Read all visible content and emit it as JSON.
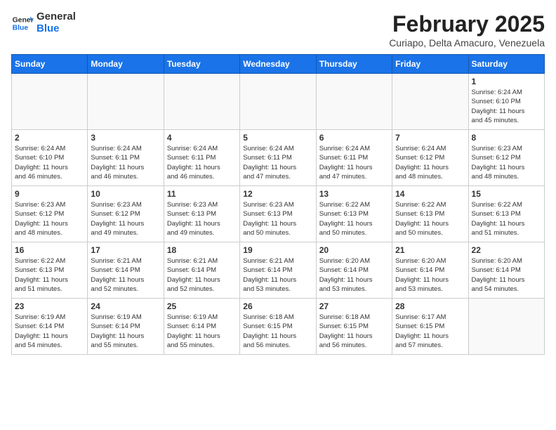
{
  "header": {
    "logo_line1": "General",
    "logo_line2": "Blue",
    "month_title": "February 2025",
    "location": "Curiapo, Delta Amacuro, Venezuela"
  },
  "days_of_week": [
    "Sunday",
    "Monday",
    "Tuesday",
    "Wednesday",
    "Thursday",
    "Friday",
    "Saturday"
  ],
  "weeks": [
    [
      {
        "day": "",
        "info": ""
      },
      {
        "day": "",
        "info": ""
      },
      {
        "day": "",
        "info": ""
      },
      {
        "day": "",
        "info": ""
      },
      {
        "day": "",
        "info": ""
      },
      {
        "day": "",
        "info": ""
      },
      {
        "day": "1",
        "info": "Sunrise: 6:24 AM\nSunset: 6:10 PM\nDaylight: 11 hours\nand 45 minutes."
      }
    ],
    [
      {
        "day": "2",
        "info": "Sunrise: 6:24 AM\nSunset: 6:10 PM\nDaylight: 11 hours\nand 46 minutes."
      },
      {
        "day": "3",
        "info": "Sunrise: 6:24 AM\nSunset: 6:11 PM\nDaylight: 11 hours\nand 46 minutes."
      },
      {
        "day": "4",
        "info": "Sunrise: 6:24 AM\nSunset: 6:11 PM\nDaylight: 11 hours\nand 46 minutes."
      },
      {
        "day": "5",
        "info": "Sunrise: 6:24 AM\nSunset: 6:11 PM\nDaylight: 11 hours\nand 47 minutes."
      },
      {
        "day": "6",
        "info": "Sunrise: 6:24 AM\nSunset: 6:11 PM\nDaylight: 11 hours\nand 47 minutes."
      },
      {
        "day": "7",
        "info": "Sunrise: 6:24 AM\nSunset: 6:12 PM\nDaylight: 11 hours\nand 48 minutes."
      },
      {
        "day": "8",
        "info": "Sunrise: 6:23 AM\nSunset: 6:12 PM\nDaylight: 11 hours\nand 48 minutes."
      }
    ],
    [
      {
        "day": "9",
        "info": "Sunrise: 6:23 AM\nSunset: 6:12 PM\nDaylight: 11 hours\nand 48 minutes."
      },
      {
        "day": "10",
        "info": "Sunrise: 6:23 AM\nSunset: 6:12 PM\nDaylight: 11 hours\nand 49 minutes."
      },
      {
        "day": "11",
        "info": "Sunrise: 6:23 AM\nSunset: 6:13 PM\nDaylight: 11 hours\nand 49 minutes."
      },
      {
        "day": "12",
        "info": "Sunrise: 6:23 AM\nSunset: 6:13 PM\nDaylight: 11 hours\nand 50 minutes."
      },
      {
        "day": "13",
        "info": "Sunrise: 6:22 AM\nSunset: 6:13 PM\nDaylight: 11 hours\nand 50 minutes."
      },
      {
        "day": "14",
        "info": "Sunrise: 6:22 AM\nSunset: 6:13 PM\nDaylight: 11 hours\nand 50 minutes."
      },
      {
        "day": "15",
        "info": "Sunrise: 6:22 AM\nSunset: 6:13 PM\nDaylight: 11 hours\nand 51 minutes."
      }
    ],
    [
      {
        "day": "16",
        "info": "Sunrise: 6:22 AM\nSunset: 6:13 PM\nDaylight: 11 hours\nand 51 minutes."
      },
      {
        "day": "17",
        "info": "Sunrise: 6:21 AM\nSunset: 6:14 PM\nDaylight: 11 hours\nand 52 minutes."
      },
      {
        "day": "18",
        "info": "Sunrise: 6:21 AM\nSunset: 6:14 PM\nDaylight: 11 hours\nand 52 minutes."
      },
      {
        "day": "19",
        "info": "Sunrise: 6:21 AM\nSunset: 6:14 PM\nDaylight: 11 hours\nand 53 minutes."
      },
      {
        "day": "20",
        "info": "Sunrise: 6:20 AM\nSunset: 6:14 PM\nDaylight: 11 hours\nand 53 minutes."
      },
      {
        "day": "21",
        "info": "Sunrise: 6:20 AM\nSunset: 6:14 PM\nDaylight: 11 hours\nand 53 minutes."
      },
      {
        "day": "22",
        "info": "Sunrise: 6:20 AM\nSunset: 6:14 PM\nDaylight: 11 hours\nand 54 minutes."
      }
    ],
    [
      {
        "day": "23",
        "info": "Sunrise: 6:19 AM\nSunset: 6:14 PM\nDaylight: 11 hours\nand 54 minutes."
      },
      {
        "day": "24",
        "info": "Sunrise: 6:19 AM\nSunset: 6:14 PM\nDaylight: 11 hours\nand 55 minutes."
      },
      {
        "day": "25",
        "info": "Sunrise: 6:19 AM\nSunset: 6:14 PM\nDaylight: 11 hours\nand 55 minutes."
      },
      {
        "day": "26",
        "info": "Sunrise: 6:18 AM\nSunset: 6:15 PM\nDaylight: 11 hours\nand 56 minutes."
      },
      {
        "day": "27",
        "info": "Sunrise: 6:18 AM\nSunset: 6:15 PM\nDaylight: 11 hours\nand 56 minutes."
      },
      {
        "day": "28",
        "info": "Sunrise: 6:17 AM\nSunset: 6:15 PM\nDaylight: 11 hours\nand 57 minutes."
      },
      {
        "day": "",
        "info": ""
      }
    ]
  ]
}
